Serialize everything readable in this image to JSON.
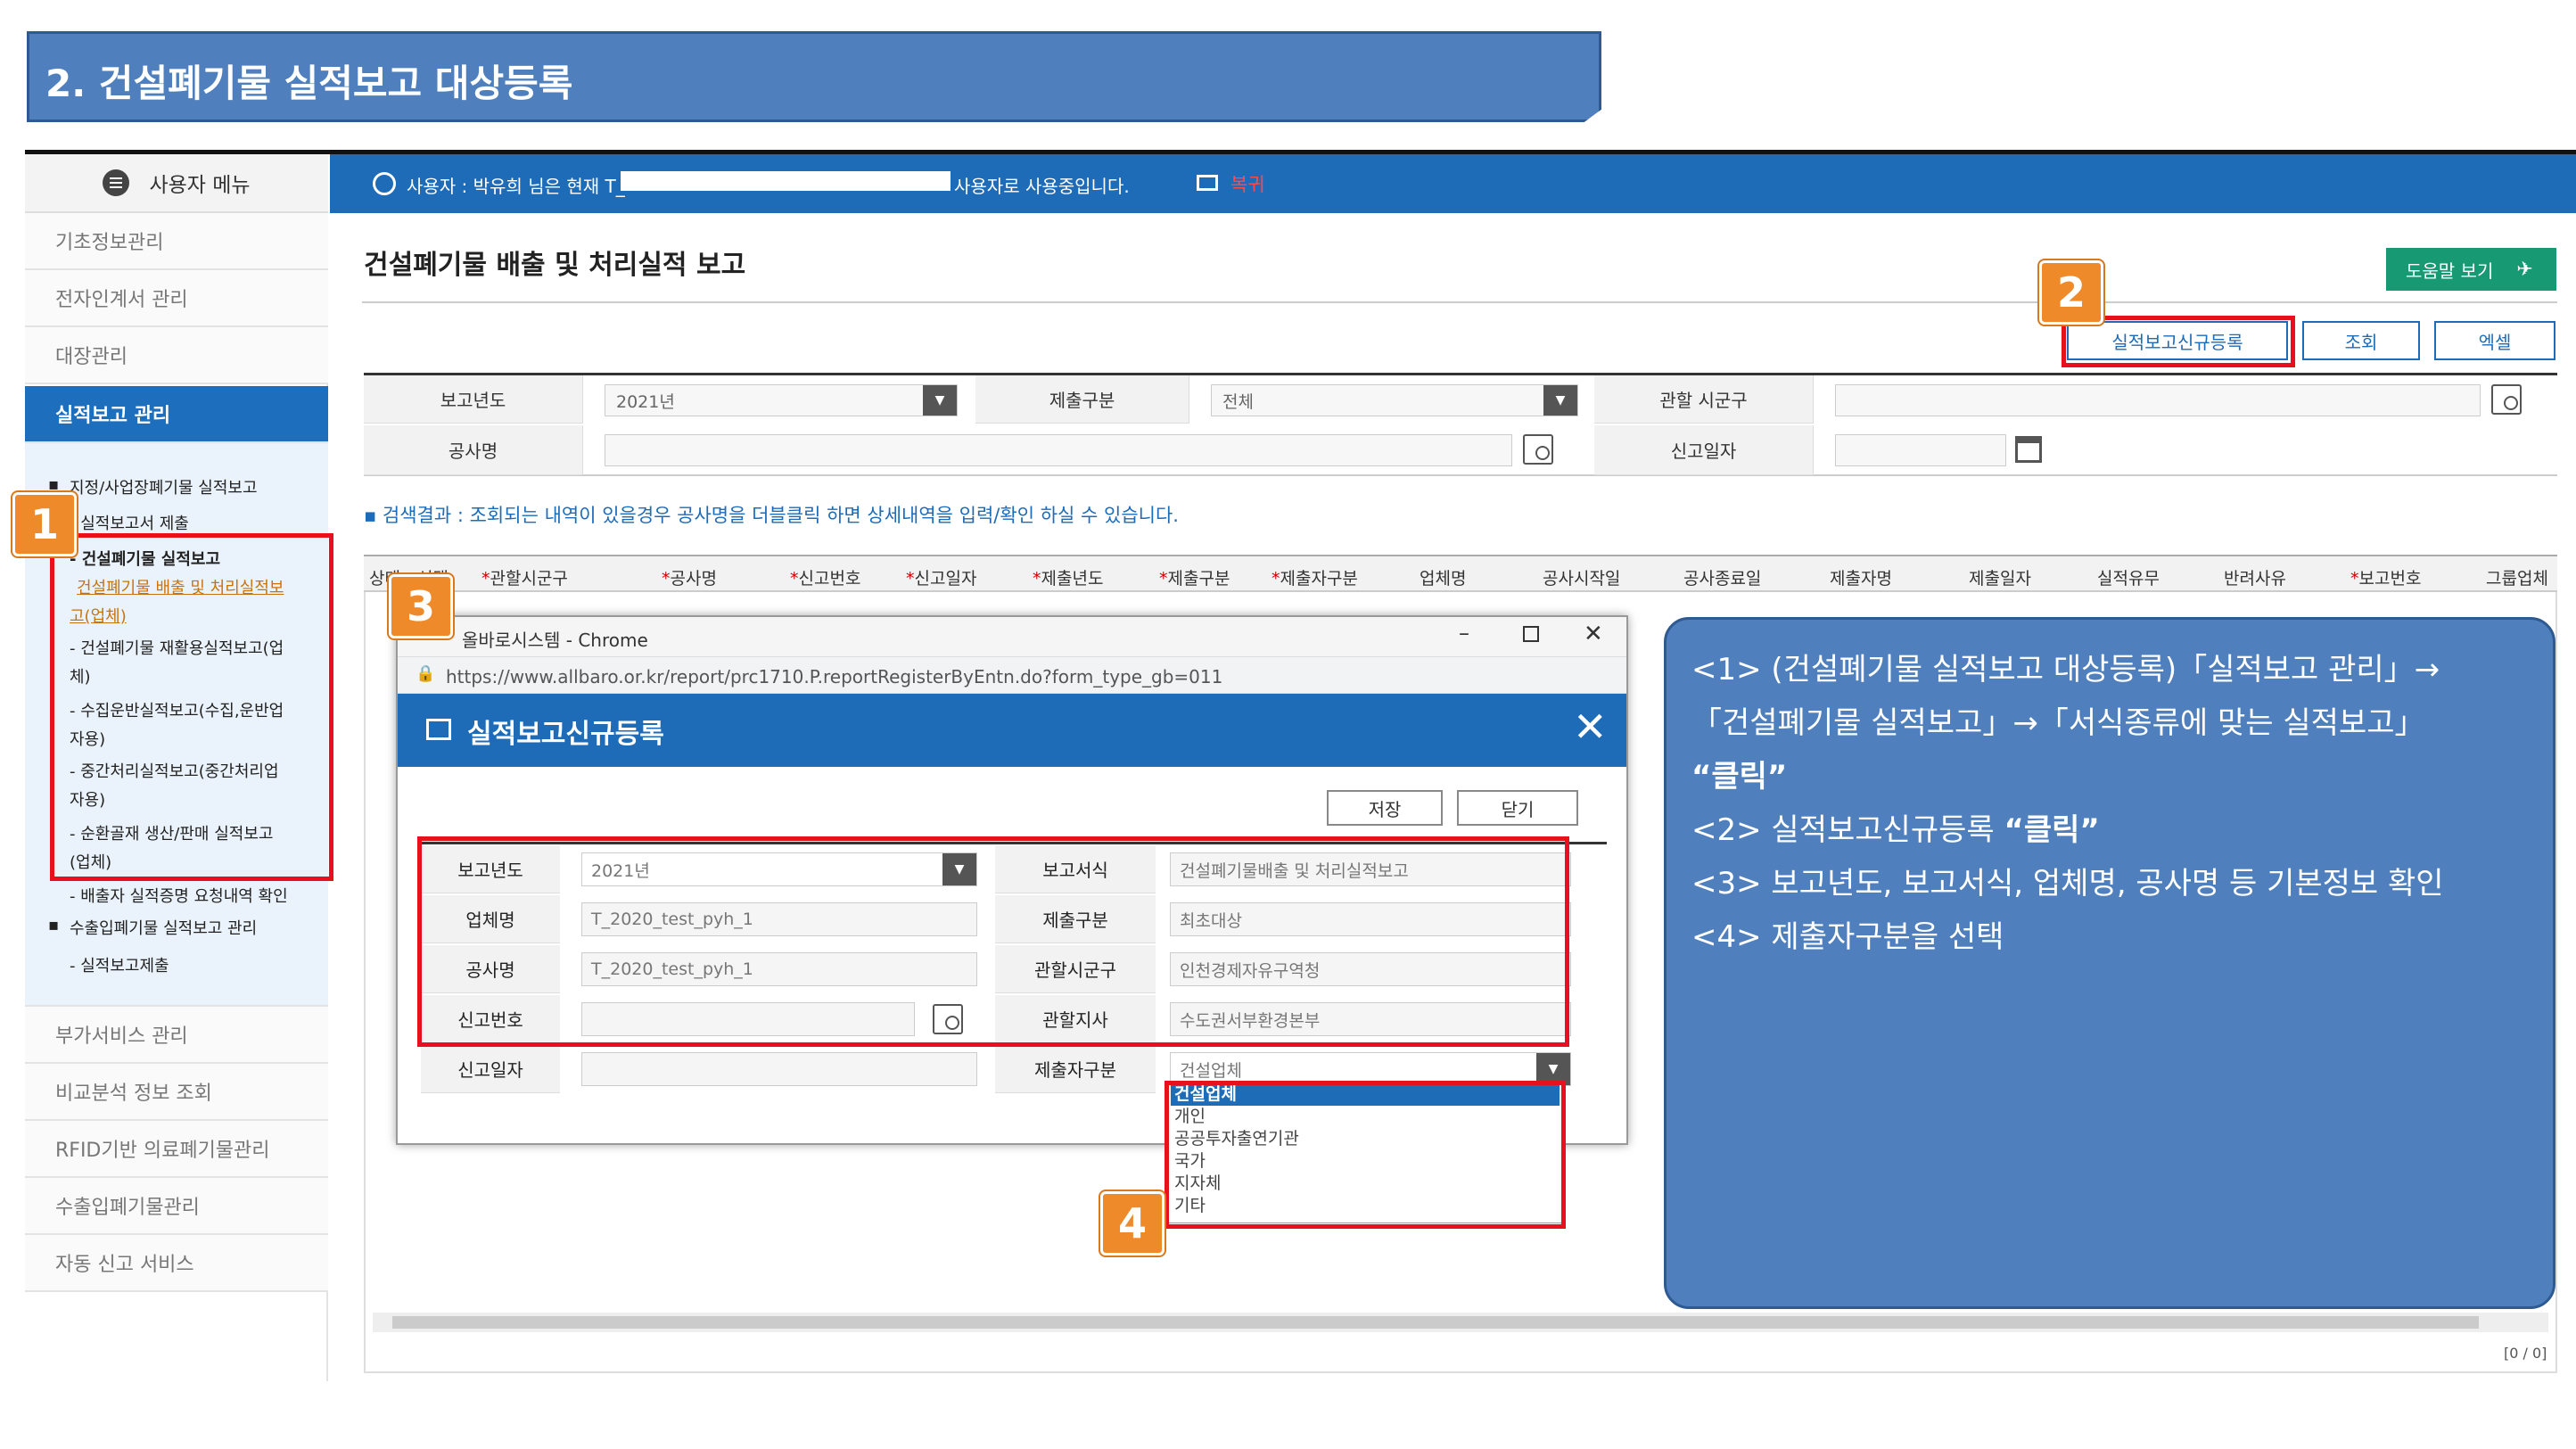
{
  "slide_title": "2. 건설폐기물 실적보고 대상등록",
  "sidebar": {
    "header": "사용자 메뉴",
    "items_top": [
      "기초정보관리",
      "전자인계서 관리",
      "대장관리"
    ],
    "active": "실적보고 관리",
    "sub": {
      "s1": "지정/사업장폐기물 실적보고",
      "s2": "- 실적보고서 제출",
      "s3": "- 건설폐기물 실적보고",
      "s4a": "건설폐기물 배출 및 처리실적보",
      "s4b": "고(업체)",
      "s5a": "- 건설폐기물 재활용실적보고(업",
      "s5b": "체)",
      "s6a": "- 수집운반실적보고(수집,운반업",
      "s6b": "자용)",
      "s7a": "- 중간처리실적보고(중간처리업",
      "s7b": "자용)",
      "s8a": "- 순환골재 생산/판매 실적보고",
      "s8b": "(업체)",
      "s9": "- 배출자 실적증명 요청내역 확인",
      "s10": "수출입폐기물 실적보고 관리",
      "s11": "- 실적보고제출"
    },
    "items_bottom": [
      "부가서비스 관리",
      "비교분석 정보 조회",
      "RFID기반 의료폐기물관리",
      "수출입폐기물관리",
      "자동 신고 서비스"
    ]
  },
  "topbar": {
    "user_text": "사용자 : 박유희 님은 현재 T_",
    "user_suffix": "사용자로 사용중입니다.",
    "return": "복귀"
  },
  "page": {
    "title": "건설폐기물 배출 및 처리실적 보고",
    "help": "도움말 보기",
    "btn_register": "실적보고신규등록",
    "btn_search": "조회",
    "btn_excel": "엑셀"
  },
  "search": {
    "year_label": "보고년도",
    "year_value": "2021년",
    "submit_label": "제출구분",
    "submit_value": "전체",
    "district_label": "관할 시군구",
    "project_label": "공사명",
    "date_label": "신고일자"
  },
  "note": "▪ 검색결과 : 조회되는 내역이 있을경우 공사명을 더블클릭 하면 상세내역을 입력/확인 하실 수 있습니다.",
  "grid_headers": [
    "상태",
    "선택",
    "관할시군구",
    "공사명",
    "신고번호",
    "신고일자",
    "제출년도",
    "제출구분",
    "제출자구분",
    "업체명",
    "공사시작일",
    "공사종료일",
    "제출자명",
    "제출일자",
    "실적유무",
    "반려사유",
    "보고번호",
    "그룹업체"
  ],
  "pager": "[0 / 0]",
  "popup": {
    "window_title": "올바로시스템 - Chrome",
    "url": "https://www.allbaro.or.kr/report/prc1710.P.reportRegisterByEntn.do?form_type_gb=011",
    "header": "실적보고신규등록",
    "save": "저장",
    "close": "닫기",
    "fields": {
      "year_label": "보고년도",
      "year_value": "2021년",
      "form_label": "보고서식",
      "form_value": "건설폐기물배출 및 처리실적보고",
      "company_label": "업체명",
      "company_value": "T_2020_test_pyh_1",
      "submit_label": "제출구분",
      "submit_value": "최초대상",
      "project_label": "공사명",
      "project_value": "T_2020_test_pyh_1",
      "district_label": "관할시군구",
      "district_value": "인천경제자유구역청",
      "reportno_label": "신고번호",
      "branch_label": "관할지사",
      "branch_value": "수도권서부환경본부",
      "date_label": "신고일자",
      "submitter_label": "제출자구분",
      "submitter_value": "건설업체"
    },
    "dropdown": [
      "건설업체",
      "개인",
      "공공투자출연기관",
      "국가",
      "지자체",
      "기타"
    ]
  },
  "badges": [
    "1",
    "2",
    "3",
    "4"
  ],
  "info": {
    "l1": "<1> (건설폐기물 실적보고 대상등록)「실적보고 관리」→",
    "l2": "「건설폐기물 실적보고」→「서식종류에 맞는 실적보고」",
    "l3": "“클릭”",
    "l4a": "<2> 실적보고신규등록 ",
    "l4b": "“클릭”",
    "l5": "<3> 보고년도, 보고서식, 업체명, 공사명 등 기본정보 확인",
    "l6": "<4> 제출자구분을 선택"
  },
  "colors": {
    "accent": "#1e6bb8",
    "banner": "#4f80bd",
    "highlight": "#e8101c",
    "badge": "#ef8a2a",
    "help": "#179a73"
  }
}
